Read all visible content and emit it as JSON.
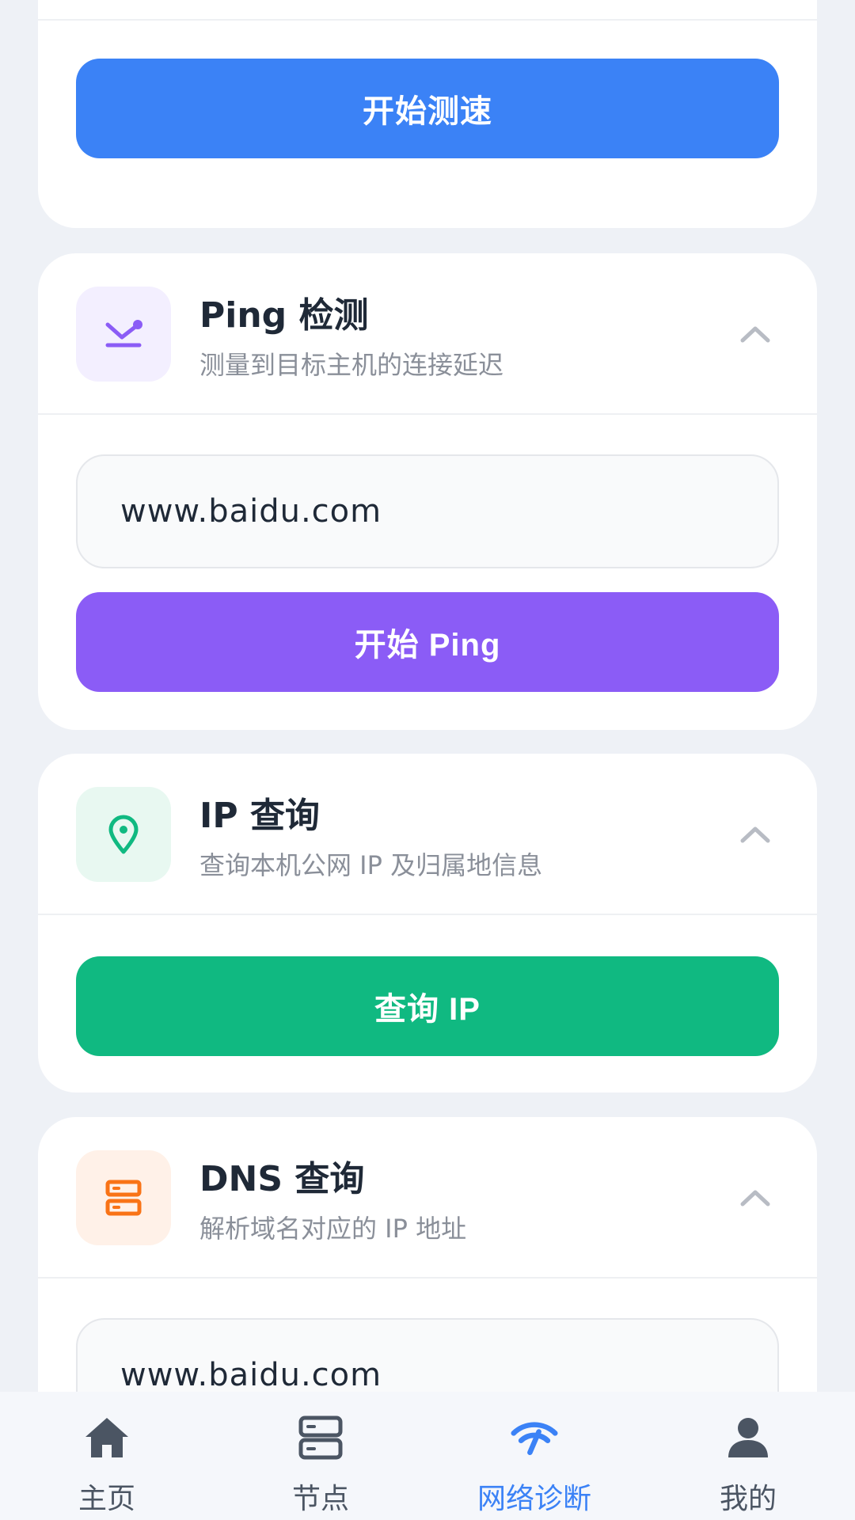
{
  "speed_card": {
    "button_label": "开始测速",
    "accent": "#3b82f6"
  },
  "ping_card": {
    "title": "Ping 检测",
    "subtitle": "测量到目标主机的连接延迟",
    "icon": "ping-arrow-icon",
    "icon_color": "#8b5cf6",
    "icon_bg": "#f3efff",
    "input_value": "www.baidu.com",
    "button_label": "开始 Ping",
    "accent": "#8b5cf6"
  },
  "ip_card": {
    "title": "IP 查询",
    "subtitle": "查询本机公网 IP 及归属地信息",
    "icon": "location-pin-icon",
    "icon_color": "#10b981",
    "icon_bg": "#e8f8f1",
    "button_label": "查询 IP",
    "accent": "#10b981"
  },
  "dns_card": {
    "title": "DNS 查询",
    "subtitle": "解析域名对应的 IP 地址",
    "icon": "server-icon",
    "icon_color": "#f97316",
    "icon_bg": "#fff1e8",
    "input_value": "www.baidu.com"
  },
  "bottom_nav": {
    "items": [
      {
        "label": "主页",
        "icon": "home-icon",
        "active": false
      },
      {
        "label": "节点",
        "icon": "server-icon",
        "active": false
      },
      {
        "label": "网络诊断",
        "icon": "wifi-icon",
        "active": true
      },
      {
        "label": "我的",
        "icon": "user-icon",
        "active": false
      }
    ],
    "active_color": "#3b82f6",
    "inactive_color": "#4b5563"
  }
}
